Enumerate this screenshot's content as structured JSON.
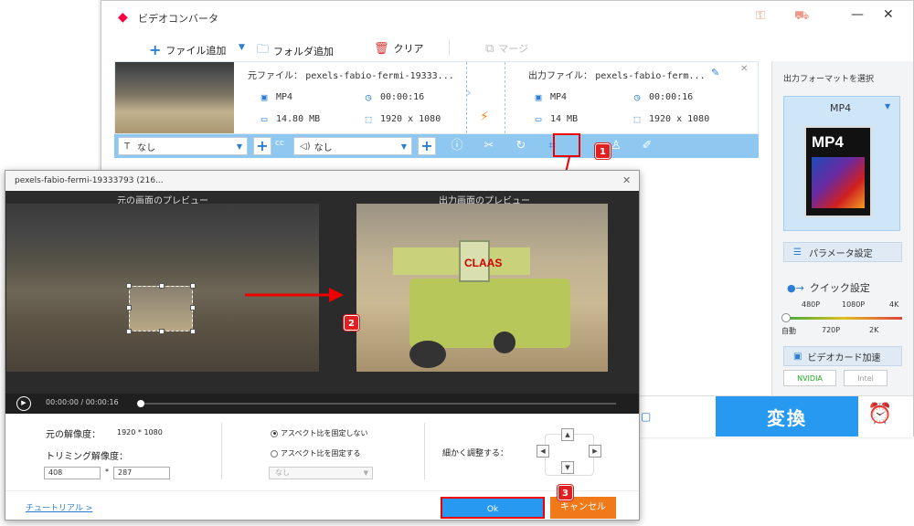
{
  "app": {
    "title": "ビデオコンバータ"
  },
  "toolbar": {
    "add_file": "ファイル追加",
    "add_folder": "フォルダ追加",
    "clear": "クリア",
    "merge": "マージ"
  },
  "source": {
    "label": "元ファイル：",
    "filename": "pexels-fabio-fermi-19333...",
    "format": "MP4",
    "duration": "00:00:16",
    "size": "14.80 MB",
    "resolution": "1920 x 1080"
  },
  "output": {
    "label": "出力ファイル：",
    "filename": "pexels-fabio-ferm...",
    "format": "MP4",
    "duration": "00:00:16",
    "size": "14 MB",
    "resolution": "1920 x 1080"
  },
  "controls": {
    "subtitle_value": "なし",
    "audio_value": "なし"
  },
  "right_panel": {
    "select_format_label": "出力フォーマットを選択",
    "format": "MP4",
    "format_icon_text": "MP4",
    "param_button": "パラメータ設定",
    "quick_label": "クイック設定",
    "presets_top": [
      "480P",
      "1080P",
      "4K"
    ],
    "presets_bottom": [
      "自動",
      "720P",
      "2K"
    ],
    "gpu_label": "ビデオカード加速",
    "vendors": [
      "NVIDIA",
      "Intel"
    ]
  },
  "bottom": {
    "convert": "変換"
  },
  "dialog": {
    "title": "pexels-fabio-fermi-19333793 (216...",
    "orig_preview_label": "元の画面のプレビュー",
    "out_preview_label": "出力画面のプレビュー",
    "time": "00:00:00  /  00:00:16",
    "orig_res_label": "元の解像度：",
    "orig_res_value": "1920 * 1080",
    "trim_res_label": "トリミング解像度：",
    "trim_width": "408",
    "trim_sep": "*",
    "trim_height": "287",
    "aspect_free": "アスペクト比を固定しない",
    "aspect_fixed": "アスペクト比を固定する",
    "aspect_select": "なし",
    "fine_adjust": "細かく調整する：",
    "overlay_brand": "CLAAS",
    "tutorial_link": "チュートリアル >",
    "ok": "Ok",
    "cancel": "キャンセル"
  },
  "annotations": {
    "step1": "1",
    "step2": "2",
    "step3": "3"
  }
}
